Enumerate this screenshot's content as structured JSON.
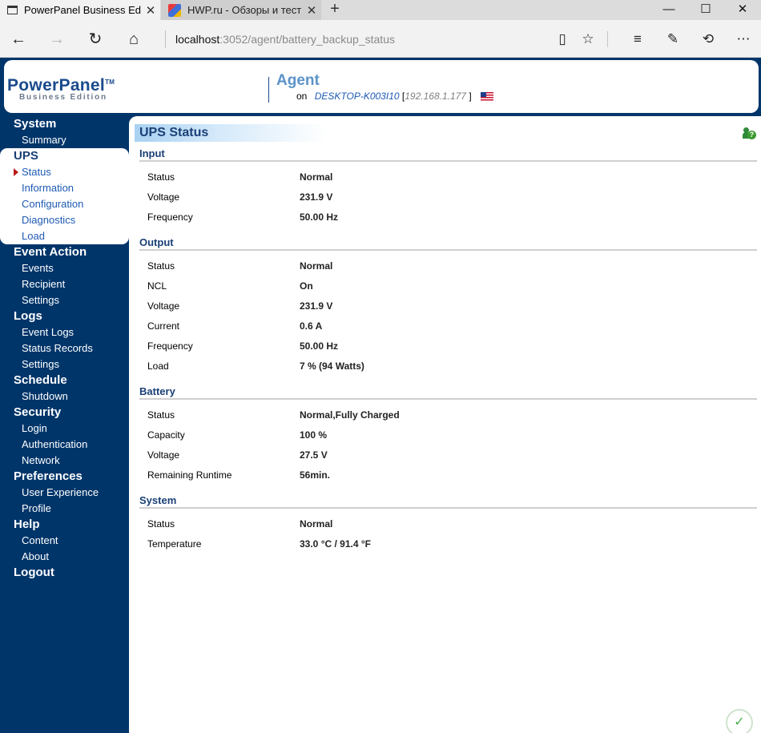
{
  "browser": {
    "tabs": [
      {
        "title": "PowerPanel Business Ed",
        "active": true
      },
      {
        "title": "HWP.ru - Обзоры и тесты к",
        "active": false
      }
    ],
    "address": {
      "host": "localhost",
      "path": ":3052/agent/battery_backup_status"
    }
  },
  "header": {
    "logo_main": "PowerPanel",
    "logo_tm": "TM",
    "logo_sub": "Business Edition",
    "agent_title": "Agent",
    "on_label": "on",
    "host": "DESKTOP-K003I10",
    "ip": "192.168.1.177",
    "bracket_open": "[",
    "bracket_close": "]"
  },
  "sidebar": {
    "items": [
      {
        "label": "System",
        "type": "category"
      },
      {
        "label": "Summary",
        "type": "sub"
      },
      {
        "label": "UPS",
        "type": "category",
        "active": true
      },
      {
        "label": "Status",
        "type": "sub",
        "active": true,
        "current": true
      },
      {
        "label": "Information",
        "type": "sub",
        "active": true
      },
      {
        "label": "Configuration",
        "type": "sub",
        "active": true
      },
      {
        "label": "Diagnostics",
        "type": "sub",
        "active": true
      },
      {
        "label": "Load",
        "type": "sub",
        "active": true
      },
      {
        "label": "Event Action",
        "type": "category"
      },
      {
        "label": "Events",
        "type": "sub"
      },
      {
        "label": "Recipient",
        "type": "sub"
      },
      {
        "label": "Settings",
        "type": "sub"
      },
      {
        "label": "Logs",
        "type": "category"
      },
      {
        "label": "Event Logs",
        "type": "sub"
      },
      {
        "label": "Status Records",
        "type": "sub"
      },
      {
        "label": "Settings",
        "type": "sub"
      },
      {
        "label": "Schedule",
        "type": "category"
      },
      {
        "label": "Shutdown",
        "type": "sub"
      },
      {
        "label": "Security",
        "type": "category"
      },
      {
        "label": "Login",
        "type": "sub"
      },
      {
        "label": "Authentication",
        "type": "sub"
      },
      {
        "label": "Network",
        "type": "sub"
      },
      {
        "label": "Preferences",
        "type": "category"
      },
      {
        "label": "User Experience",
        "type": "sub"
      },
      {
        "label": "Profile",
        "type": "sub"
      },
      {
        "label": "Help",
        "type": "category"
      },
      {
        "label": "Content",
        "type": "sub"
      },
      {
        "label": "About",
        "type": "sub"
      },
      {
        "label": "Logout",
        "type": "category"
      }
    ]
  },
  "main": {
    "title": "UPS Status",
    "sections": [
      {
        "title": "Input",
        "rows": [
          {
            "label": "Status",
            "value": "Normal"
          },
          {
            "label": "Voltage",
            "value": "231.9 V"
          },
          {
            "label": "Frequency",
            "value": "50.00 Hz"
          }
        ]
      },
      {
        "title": "Output",
        "rows": [
          {
            "label": "Status",
            "value": "Normal"
          },
          {
            "label": "NCL",
            "value": "On"
          },
          {
            "label": "Voltage",
            "value": "231.9 V"
          },
          {
            "label": "Current",
            "value": "0.6 A"
          },
          {
            "label": "Frequency",
            "value": "50.00 Hz"
          },
          {
            "label": "Load",
            "value": "7 % (94 Watts)"
          }
        ]
      },
      {
        "title": "Battery",
        "rows": [
          {
            "label": "Status",
            "value": "Normal,Fully Charged"
          },
          {
            "label": "Capacity",
            "value": "100 %"
          },
          {
            "label": "Voltage",
            "value": "27.5 V"
          },
          {
            "label": "Remaining Runtime",
            "value": "56min."
          }
        ]
      },
      {
        "title": "System",
        "rows": [
          {
            "label": "Status",
            "value": "Normal"
          },
          {
            "label": "Temperature",
            "value": "33.0 °C / 91.4 °F"
          }
        ]
      }
    ]
  },
  "icons": {
    "page": "page-icon",
    "site": "hwp-favicon-icon",
    "help": "help-person-icon",
    "shield": "shield-check-icon",
    "flag": "us-flag-icon"
  }
}
